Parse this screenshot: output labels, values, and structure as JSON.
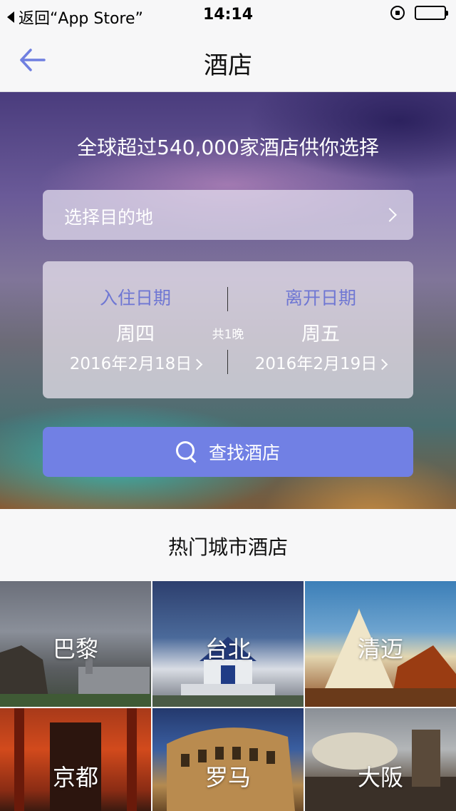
{
  "status_bar": {
    "back_label": "返回“App Store”",
    "time": "14:14"
  },
  "nav": {
    "title": "酒店"
  },
  "hero": {
    "tagline": "全球超过540,000家酒店供你选择",
    "destination_placeholder": "选择目的地",
    "checkin": {
      "label": "入住日期",
      "weekday": "周四",
      "date": "2016年2月18日"
    },
    "checkout": {
      "label": "离开日期",
      "weekday": "周五",
      "date": "2016年2月19日"
    },
    "nights": "共1晚",
    "search_button": "查找酒店"
  },
  "hot_cities": {
    "title": "热门城市酒店",
    "cities": [
      {
        "name": "巴黎"
      },
      {
        "name": "台北"
      },
      {
        "name": "清迈"
      },
      {
        "name": "京都"
      },
      {
        "name": "罗马"
      },
      {
        "name": "大阪"
      }
    ]
  },
  "colors": {
    "accent": "#7180e4",
    "date_label": "#6f77d3",
    "back_arrow": "#6f7fe0"
  }
}
